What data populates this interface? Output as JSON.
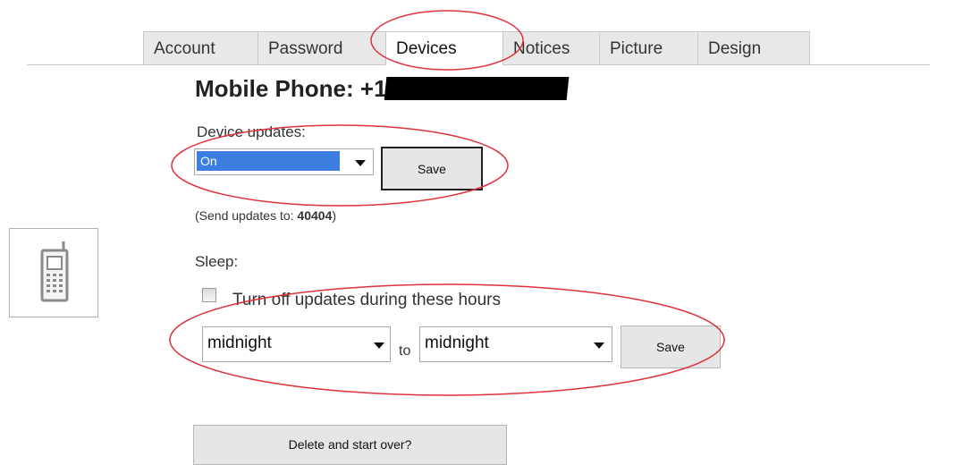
{
  "tabs": [
    {
      "label": "Account",
      "active": false
    },
    {
      "label": "Password",
      "active": false
    },
    {
      "label": "Devices",
      "active": true
    },
    {
      "label": "Notices",
      "active": false
    },
    {
      "label": "Picture",
      "active": false
    },
    {
      "label": "Design",
      "active": false
    }
  ],
  "page_title": "Mobile Phone: +1",
  "device_updates": {
    "label": "Device updates:",
    "selected": "On",
    "save_label": "Save",
    "send_to_prefix": "(Send updates to: ",
    "send_to_number": "40404",
    "send_to_suffix": ")"
  },
  "sleep": {
    "label": "Sleep:",
    "checkbox_label": "Turn off updates during these hours",
    "checked": false,
    "from_value": "midnight",
    "to_label": "to",
    "to_value": "midnight",
    "save_label": "Save"
  },
  "delete_label": "Delete and start over?",
  "icons": {
    "device": "mobile-phone-icon",
    "dropdown": "chevron-down-icon"
  },
  "colors": {
    "annotation": "#e0303a",
    "selected_highlight": "#3b7ee0",
    "tab_bg": "#e8e8e8"
  }
}
